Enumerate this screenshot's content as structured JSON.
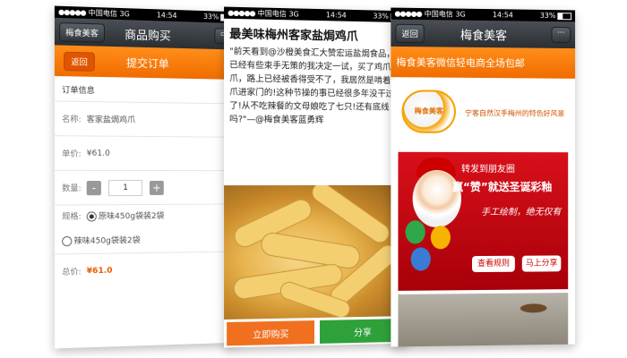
{
  "status": {
    "carrier": "中国电信",
    "network": "3G",
    "time": "14:54",
    "battery": "33%"
  },
  "phone1": {
    "wx_back": "梅食美客",
    "wx_title": "商品购买",
    "order_back": "返回",
    "order_title": "提交订单",
    "section_title": "订单信息",
    "name_label": "名称:",
    "name_value": "客家盐焗鸡爪",
    "unit_label": "单价:",
    "unit_value": "¥61.0",
    "qty_label": "数量:",
    "qty_value": "1",
    "qty_minus": "-",
    "qty_plus": "+",
    "spec_label": "规格:",
    "spec_options": [
      "原味450g袋装2袋",
      "辣味450g袋装2袋"
    ],
    "total_label": "总价:",
    "total_value": "¥61.0"
  },
  "phone2": {
    "article_title": "最美味梅州客家盐焗鸡爪",
    "article_body": "\"前天看到@沙橙美食汇大赞宏运盐焗食品，已经有些束手无策的我决定一试，买了鸡爪鸭爪，路上已经被香得受不了，我居然是啃着鸡爪进家门的!这种节操的事已经很多年没干过了!从不吃辣餐的文母娘吃了七只!还有底线吗?\"—@梅食美客蓝勇辉",
    "buy_label": "立即购买",
    "share_label": "分享"
  },
  "phone3": {
    "wx_back": "返回",
    "wx_title": "梅食美客",
    "wx_more": "···",
    "promo_text": "梅食美客微信轻电商全场包邮",
    "brand_logo_text": "梅食美客",
    "brand_slogan": "宁客自然汉手梅州的特色好风景",
    "banner_line1": "转发到朋友圈",
    "banner_line2": "赢“赞”就送圣诞彩釉",
    "banner_line3": "手工绘制，绝无仅有",
    "banner_rules": "查看规则",
    "banner_share": "马上分享"
  }
}
